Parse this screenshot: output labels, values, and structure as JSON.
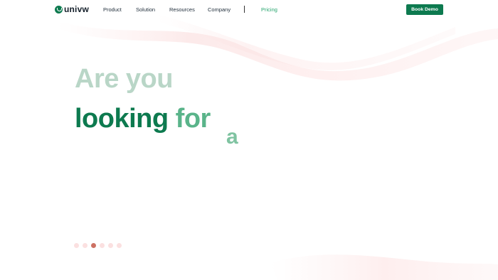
{
  "brand": {
    "name": "univw",
    "color": "#0d7a4f"
  },
  "nav": {
    "items": [
      {
        "label": "Product",
        "active": false
      },
      {
        "label": "Solution",
        "active": false
      },
      {
        "label": "Resources",
        "active": false
      },
      {
        "label": "Company",
        "active": false
      },
      {
        "label": "Pricing",
        "active": true
      }
    ],
    "cta_label": "Book Demo"
  },
  "hero": {
    "line1": "Are you",
    "line2_word1": "looking",
    "line2_word2": "for",
    "line3_word": "a"
  },
  "carousel": {
    "total": 6,
    "active_index": 2
  },
  "colors": {
    "accent": "#0d7a4f",
    "light_green": "#b9d6c7",
    "mid_green": "#5ab48a",
    "active_dot": "#cd7163",
    "inactive_dot": "#fbe0e0"
  }
}
